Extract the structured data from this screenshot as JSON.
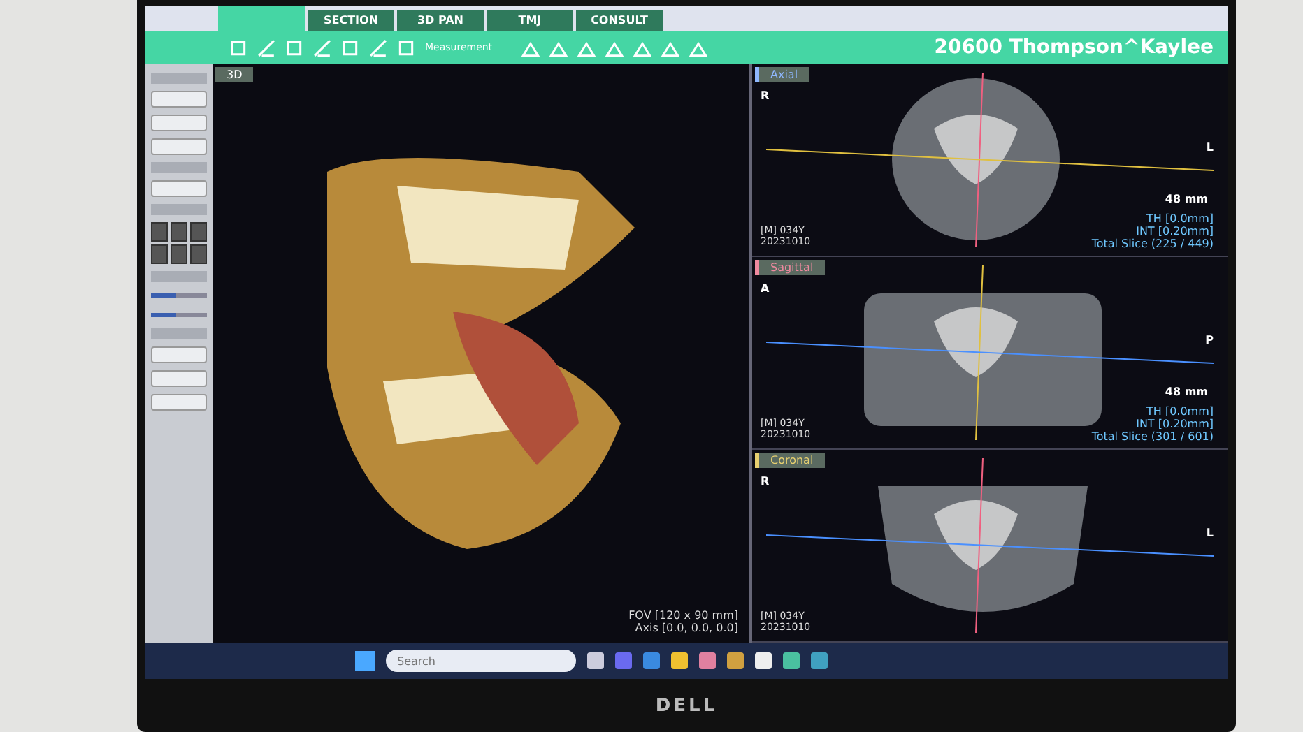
{
  "tabs": [
    {
      "selected": true
    },
    {
      "label": "SECTION",
      "selected": false
    },
    {
      "label": "3D PAN",
      "selected": false
    },
    {
      "label": "TMJ",
      "selected": false
    },
    {
      "label": "CONSULT",
      "selected": false
    }
  ],
  "toolbar": {
    "measurement_label": "Measurement"
  },
  "sidebar": {
    "sliders": [
      {
        "level": 0.45
      },
      {
        "level": 0.45
      }
    ]
  },
  "patient": "20600 Thompson^Kaylee",
  "view_3d": {
    "label": "3D",
    "fov": "FOV [120 x 90 mm]",
    "axis": "Axis [0.0, 0.0, 0.0]"
  },
  "slice_views": [
    {
      "kind": "axial",
      "label": "Axial",
      "color": "#8fb8ff",
      "top_letter": "R",
      "side_letter": "L",
      "patient_info": [
        "[M] 034Y",
        "20231010"
      ],
      "scale": "48 mm",
      "slice_info": [
        "TH [0.0mm]",
        "INT [0.20mm]",
        "Total Slice (225 / 449)"
      ]
    },
    {
      "kind": "sagittal",
      "label": "Sagittal",
      "color": "#f08aa0",
      "top_letter": "A",
      "side_letter": "P",
      "patient_info": [
        "[M] 034Y",
        "20231010"
      ],
      "scale": "48 mm",
      "slice_info": [
        "TH [0.0mm]",
        "INT [0.20mm]",
        "Total Slice (301 / 601)"
      ]
    },
    {
      "kind": "coronal",
      "label": "Coronal",
      "color": "#e8d070",
      "top_letter": "R",
      "side_letter": "L",
      "patient_info": [
        "[M] 034Y",
        "20231010"
      ]
    }
  ],
  "taskbar": {
    "search_placeholder": "Search"
  },
  "monitor_brand": "DELL"
}
